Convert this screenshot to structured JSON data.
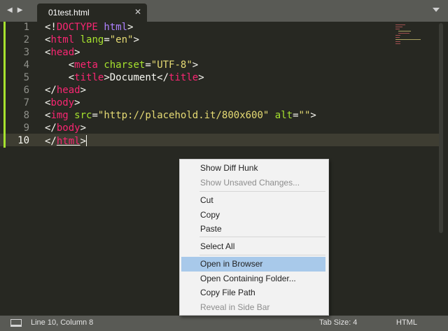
{
  "tabbar": {
    "nav_icon": "navigation-arrows-icon",
    "tab_label": "01test.html",
    "close_glyph": "✕"
  },
  "editor": {
    "line_numbers": [
      "1",
      "2",
      "3",
      "4",
      "5",
      "6",
      "7",
      "8",
      "9",
      "10"
    ],
    "lines": [
      {
        "pre": "<!",
        "kw": "DOCTYPE",
        "mid": " ",
        "dt": "html",
        "post": ">"
      },
      {
        "pre": "<",
        "kw": "html",
        "mid": " ",
        "at": "lang",
        "eq": "=",
        "st": "\"en\"",
        "post": ">"
      },
      {
        "pre": "<",
        "kw": "head",
        "post": ">"
      },
      {
        "indent": "    ",
        "pre": "<",
        "kw": "meta",
        "mid": " ",
        "at": "charset",
        "eq": "=",
        "st": "\"UTF-8\"",
        "post": ">"
      },
      {
        "indent": "    ",
        "pre": "<",
        "kw": "title",
        "post": ">Document</",
        "kw2": "title",
        "post2": ">"
      },
      {
        "pre": "</",
        "kw": "head",
        "post": ">"
      },
      {
        "pre": "<",
        "kw": "body",
        "post": ">"
      },
      {
        "pre": "<",
        "kw": "img",
        "mid": " ",
        "at": "src",
        "eq": "=",
        "st": "\"http://placehold.it/800x600\"",
        "mid2": " ",
        "at2": "alt",
        "eq2": "=",
        "st2": "\"\"",
        "post": ">"
      },
      {
        "pre": "</",
        "kw": "body",
        "post": ">"
      },
      {
        "pre": "</",
        "kw": "html",
        "post": ">"
      }
    ],
    "active_line": "10",
    "colors": {
      "background": "#272822",
      "tag": "#f92672",
      "attribute": "#a6e22e",
      "string": "#e6db74",
      "doctype": "#ae81ff",
      "modified_marker": "#a6e22e"
    }
  },
  "context_menu": {
    "items": [
      {
        "label": "Show Diff Hunk",
        "enabled": true
      },
      {
        "label": "Show Unsaved Changes...",
        "enabled": false
      },
      {
        "label": "Cut",
        "enabled": true
      },
      {
        "label": "Copy",
        "enabled": true
      },
      {
        "label": "Paste",
        "enabled": true
      },
      {
        "label": "Select All",
        "enabled": true
      },
      {
        "label": "Open in Browser",
        "enabled": true,
        "highlighted": true
      },
      {
        "label": "Open Containing Folder...",
        "enabled": true
      },
      {
        "label": "Copy File Path",
        "enabled": true
      },
      {
        "label": "Reveal in Side Bar",
        "enabled": false
      }
    ],
    "highlight_color": "#a8c9ea"
  },
  "statusbar": {
    "panel_icon": "panel-toggle-icon",
    "position": "Line 10, Column 8",
    "tab_size": "Tab Size: 4",
    "syntax": "HTML"
  }
}
